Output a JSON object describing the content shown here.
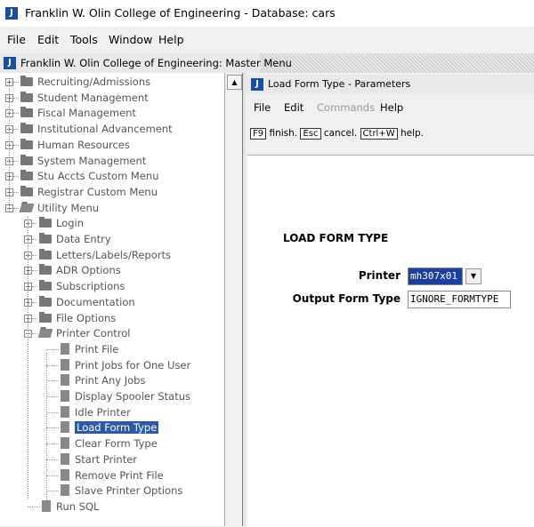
{
  "window": {
    "title": "Franklin W. Olin College of Engineering - Database: cars",
    "icon": "j-app-icon"
  },
  "menubar": [
    {
      "label": "File"
    },
    {
      "label": "Edit"
    },
    {
      "label": "Tools"
    },
    {
      "label": "Window"
    },
    {
      "label": "Help"
    }
  ],
  "master": {
    "title": "Franklin W. Olin College of Engineering: Master Menu"
  },
  "tree": {
    "top": [
      "Recruiting/Admissions",
      "Student Management",
      "Fiscal Management",
      "Institutional Advancement",
      "Human Resources",
      "System Management",
      "Stu Accts Custom Menu",
      "Registrar Custom Menu",
      "Utility Menu"
    ],
    "utility": [
      "Login",
      "Data Entry",
      "Letters/Labels/Reports",
      "ADR Options",
      "Subscriptions",
      "Documentation",
      "File Options",
      "Printer Control"
    ],
    "printer": [
      "Print File",
      "Print Jobs for One User",
      "Print Any Jobs",
      "Display Spooler Status",
      "Idle Printer",
      "Load Form Type",
      "Clear Form Type",
      "Start Printer",
      "Remove Print File",
      "Slave Printer Options"
    ],
    "run_sql": "Run SQL"
  },
  "form": {
    "title": "Load Form Type - Parameters",
    "menu": {
      "file": "File",
      "edit": "Edit",
      "commands": "Commands",
      "help": "Help"
    },
    "hint": {
      "k1": "F9",
      "t1": "finish.",
      "k2": "Esc",
      "t2": "cancel.",
      "k3": "Ctrl+W",
      "t3": "help."
    },
    "section": "LOAD FORM TYPE",
    "printer_label": "Printer",
    "printer_value": "mh307x01",
    "output_label": "Output Form Type",
    "output_value": "IGNORE_FORMTYPE"
  },
  "colors": {
    "selection": "#2c5aa9",
    "app_icon": "#1a4fa0"
  }
}
